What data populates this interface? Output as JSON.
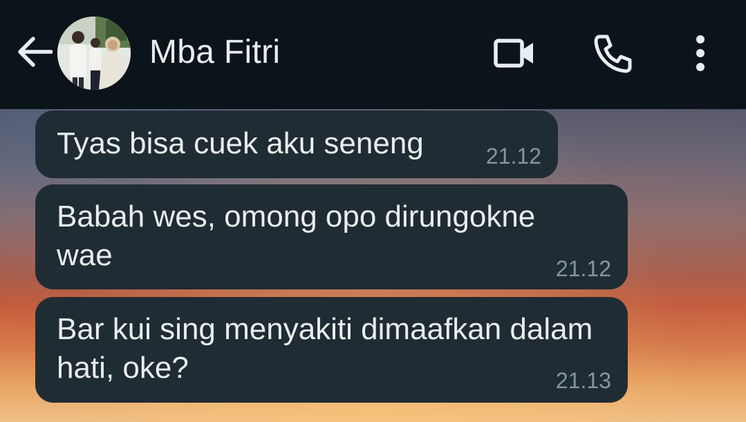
{
  "header": {
    "contact_name": "Mba Fitri",
    "back_icon": "arrow-left-icon",
    "video_icon": "video-call-icon",
    "call_icon": "phone-icon",
    "menu_icon": "more-vertical-icon",
    "background_color": "#0b141a"
  },
  "messages": [
    {
      "text": "Tyas bisa cuek aku seneng",
      "time": "21.12",
      "direction": "incoming"
    },
    {
      "text": "Babah wes, omong opo dirungokne wae",
      "time": "21.12",
      "direction": "incoming"
    },
    {
      "text": "Bar kui sing menyakiti dimaafkan dalam hati, oke?",
      "time": "21.13",
      "direction": "incoming"
    }
  ],
  "colors": {
    "bubble": "#202c33",
    "text": "#e9edef",
    "timestamp": "#8696a0"
  }
}
